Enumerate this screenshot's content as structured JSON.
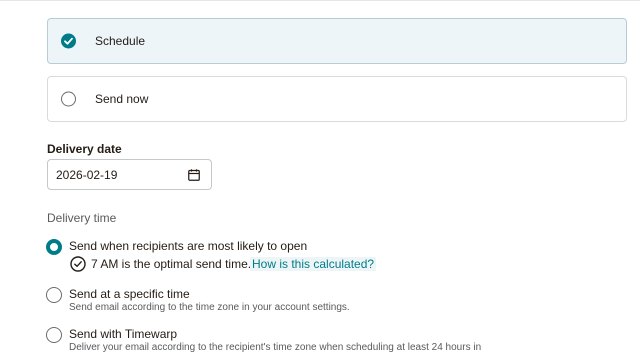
{
  "send_options": {
    "schedule_label": "Schedule",
    "send_now_label": "Send now",
    "selected": "Schedule"
  },
  "delivery_date": {
    "label": "Delivery date",
    "value": "2026-02-19"
  },
  "delivery_time": {
    "label": "Delivery time",
    "options": [
      {
        "title": "Send when recipients are most likely to open",
        "selected": true
      },
      {
        "title": "Send at a specific time",
        "subtitle": "Send email according to the time zone in your account settings.",
        "selected": false
      },
      {
        "title": "Send with Timewarp",
        "subtitle": "Deliver your email according to the recipient's time zone when scheduling at least 24 hours in",
        "selected": false
      }
    ],
    "optimal_text": "7 AM is the optimal send time.",
    "optimal_link": "How is this calculated?"
  },
  "colors": {
    "accent": "#007c89",
    "selected_card_bg": "#edf5f8"
  },
  "icons": {
    "date_picker": "calendar-icon",
    "optimal": "check-circle-icon"
  }
}
